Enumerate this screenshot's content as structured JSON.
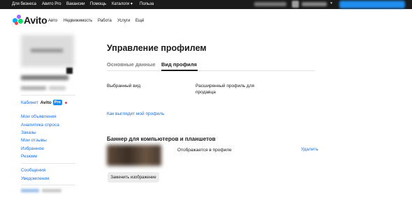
{
  "topbar": {
    "links": [
      "Для бизнеса",
      "Авито Pro",
      "Вакансии",
      "Помощь",
      "Каталоги ▾",
      "Польза"
    ]
  },
  "logo": {
    "text": "Avito"
  },
  "subnav": {
    "items": [
      "Авто",
      "Недвижимость",
      "Работа",
      "Услуги",
      "Ещё"
    ]
  },
  "sidebar": {
    "cabinet": {
      "label": "Кабинет",
      "brand": "Avito",
      "badge": "Pro"
    },
    "links_group1": [
      "Мои объявления",
      "Аналитика спроса",
      "Заказы",
      "Мои отзывы",
      "Избранное",
      "Резюме"
    ],
    "links_group2": [
      "Сообщения",
      "Уведомления"
    ]
  },
  "main": {
    "title": "Управление профилем",
    "tabs": [
      {
        "label": "Основные данные",
        "active": false
      },
      {
        "label": "Вид профиля",
        "active": true
      }
    ],
    "selected_view": {
      "label": "Выбранный вид",
      "value": "Расширенный профиль для продавца"
    },
    "preview_link": "Как выглядит мой профиль",
    "banner": {
      "title": "Баннер для компьютеров и планшетов",
      "status": "Отображается в профиле",
      "delete_label": "Удалить",
      "replace_label": "Заменить изображение"
    }
  },
  "colors": {
    "link": "#1a6fe0",
    "accent": "#1e8ef0",
    "topbar": "#1b1b1b"
  }
}
